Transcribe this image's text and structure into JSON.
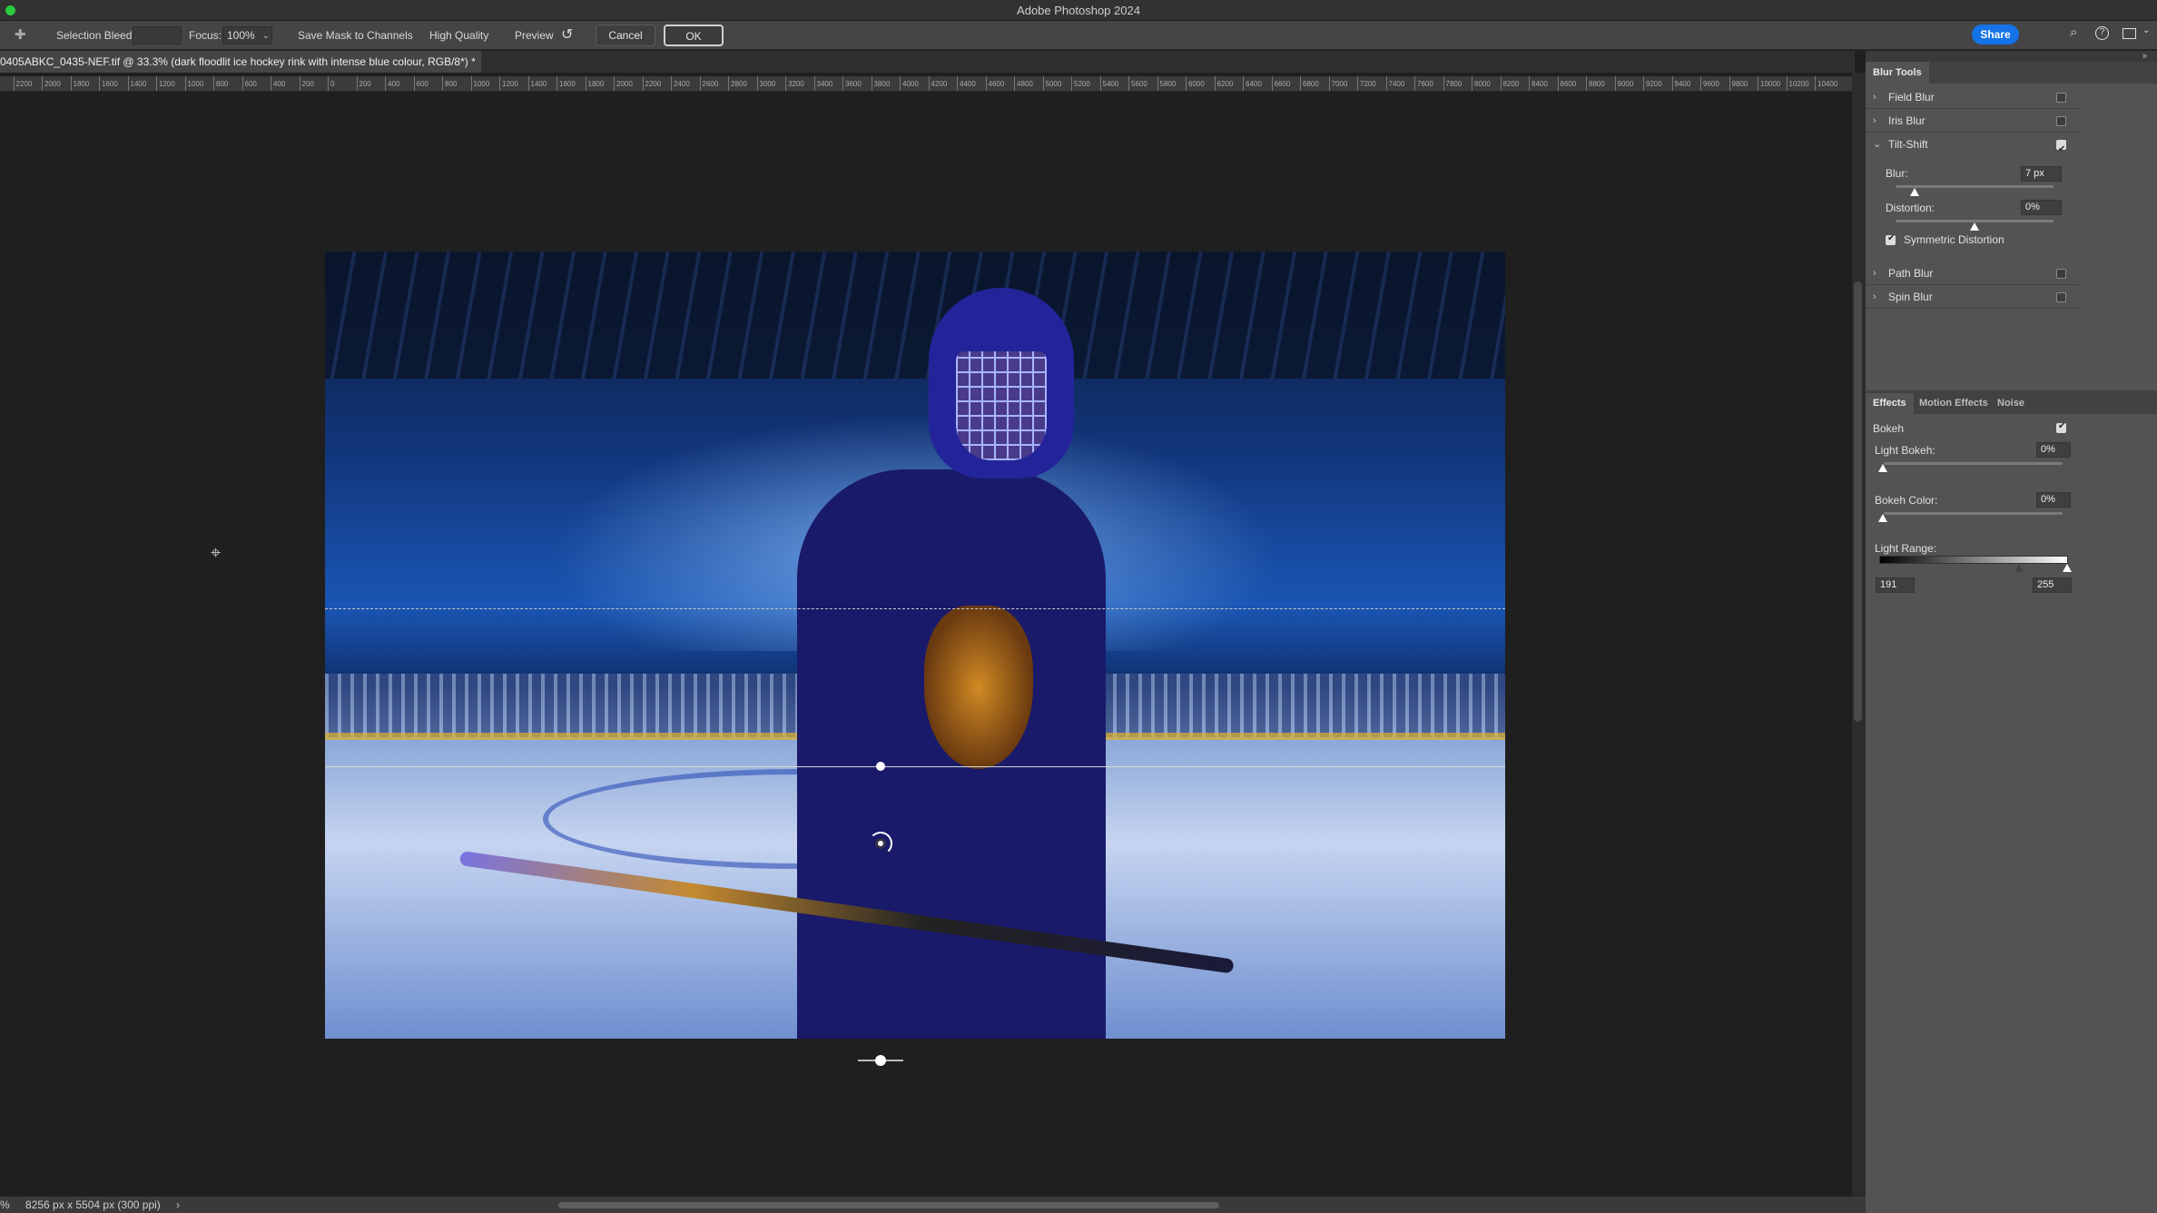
{
  "app": {
    "title": "Adobe Photoshop 2024"
  },
  "options": {
    "selection_bleed_label": "Selection Bleed:",
    "selection_bleed_value": "",
    "focus_label": "Focus:",
    "focus_value": "100%",
    "save_mask_label": "Save Mask to Channels",
    "save_mask_checked": false,
    "high_quality_label": "High Quality",
    "high_quality_checked": false,
    "preview_label": "Preview",
    "preview_checked": true,
    "cancel_label": "Cancel",
    "ok_label": "OK",
    "share_label": "Share"
  },
  "document": {
    "tab_title": "0405ABKC_0435-NEF.tif @ 33.3% (dark floodlit ice hockey rink with intense blue colour, RGB/8*) *"
  },
  "ruler": {
    "labels": [
      "2200",
      "2000",
      "1800",
      "1600",
      "1400",
      "1200",
      "1000",
      "800",
      "600",
      "400",
      "200",
      "0",
      "200",
      "400",
      "600",
      "800",
      "1000",
      "1200",
      "1400",
      "1600",
      "1800",
      "2000",
      "2200",
      "2400",
      "2600",
      "2800",
      "3000",
      "3200",
      "3400",
      "3600",
      "3800",
      "4000",
      "4200",
      "4400",
      "4600",
      "4800",
      "5000",
      "5200",
      "5400",
      "5600",
      "5800",
      "6000",
      "6200",
      "6400",
      "6600",
      "6800",
      "7000",
      "7200",
      "7400",
      "7600",
      "7800",
      "8000",
      "8200",
      "8400",
      "8600",
      "8800",
      "9000",
      "9200",
      "9400",
      "9600",
      "9800",
      "10000",
      "10200",
      "10400"
    ]
  },
  "status": {
    "zoom_fragment": "%",
    "dimensions": "8256 px x 5504 px (300 ppi)",
    "arrow": "›"
  },
  "blur_tools": {
    "tab": "Blur Tools",
    "items": [
      {
        "label": "Field Blur",
        "checked": false,
        "expanded": false
      },
      {
        "label": "Iris Blur",
        "checked": false,
        "expanded": false
      },
      {
        "label": "Tilt-Shift",
        "checked": true,
        "expanded": true
      },
      {
        "label": "Path Blur",
        "checked": false,
        "expanded": false
      },
      {
        "label": "Spin Blur",
        "checked": false,
        "expanded": false
      }
    ],
    "tilt_shift": {
      "blur_label": "Blur:",
      "blur_value": "7 px",
      "blur_slider_fraction": 0.12,
      "distortion_label": "Distortion:",
      "distortion_value": "0%",
      "distortion_slider_fraction": 0.5,
      "symmetric_label": "Symmetric Distortion",
      "symmetric_checked": true
    }
  },
  "effects": {
    "tabs": [
      "Effects",
      "Motion Effects",
      "Noise"
    ],
    "active_tab": "Effects",
    "bokeh_label": "Bokeh",
    "bokeh_checked": true,
    "light_bokeh_label": "Light Bokeh:",
    "light_bokeh_value": "0%",
    "bokeh_color_label": "Bokeh Color:",
    "bokeh_color_value": "0%",
    "light_range_label": "Light Range:",
    "light_range_low": "191",
    "light_range_high": "255"
  },
  "colors": {
    "accent": "#1473e6",
    "panel": "#535353",
    "canvas": "#1f1f1f"
  }
}
